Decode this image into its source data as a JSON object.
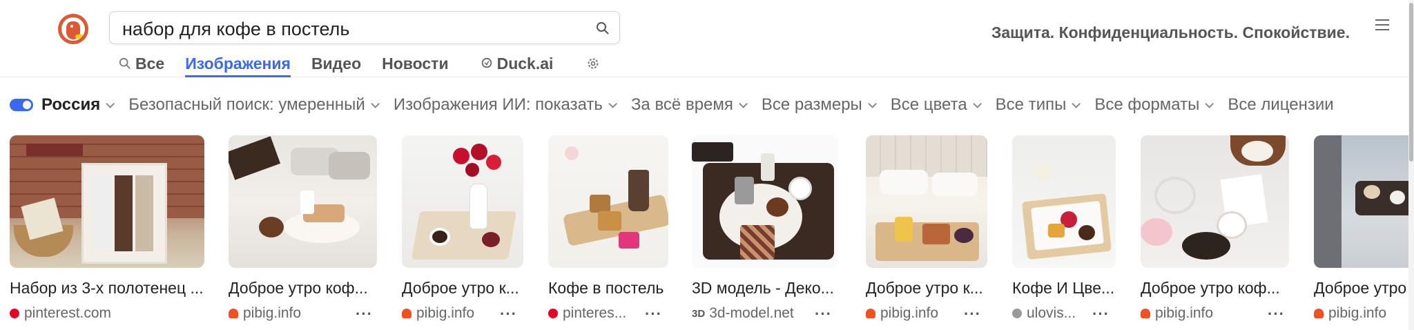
{
  "search": {
    "query": "набор для кофе в постель"
  },
  "tagline": "Защита. Конфиденциальность. Спокойствие.",
  "tabs": [
    {
      "label": "Все",
      "icon": "search-icon"
    },
    {
      "label": "Изображения",
      "active": true
    },
    {
      "label": "Видео"
    },
    {
      "label": "Новости"
    },
    {
      "label": "Duck.ai",
      "icon": "chat-icon"
    },
    {
      "label": "",
      "icon": "gear-icon"
    }
  ],
  "filters": {
    "region": "Россия",
    "safe_search": "Безопасный поиск: умеренный",
    "ai_images": "Изображения ИИ: показать",
    "time": "За всё время",
    "size": "Все размеры",
    "color": "Все цвета",
    "type": "Все типы",
    "format": "Все форматы",
    "license": "Все лицензии"
  },
  "results": [
    {
      "title": "Набор из 3-х полотенец ...",
      "source": "pinterest.com",
      "source_color": "#e60023",
      "more": "···"
    },
    {
      "title": "Доброе утро коф...",
      "source": "pibig.info",
      "source_color": "#f25022",
      "more": "···"
    },
    {
      "title": "Доброе утро к...",
      "source": "pibig.info",
      "source_color": "#f25022",
      "more": "···"
    },
    {
      "title": "Кофе в постель",
      "source": "pinteres...",
      "source_color": "#e60023",
      "more": "···"
    },
    {
      "title": "3D модель - Деко...",
      "source": "3d-model.net",
      "source_color": "#555555",
      "source_badge": "3D",
      "more": "···"
    },
    {
      "title": "Доброе утро к...",
      "source": "pibig.info",
      "source_color": "#f25022",
      "more": "···"
    },
    {
      "title": "Кофе И Цве...",
      "source": "ulovis...",
      "source_color": "#999999",
      "more": "···"
    },
    {
      "title": "Доброе утро коф...",
      "source": "pibig.info",
      "source_color": "#f25022",
      "more": "···"
    },
    {
      "title": "Доброе утро",
      "source": "pibig.info",
      "source_color": "#f25022",
      "more": ""
    }
  ],
  "colors": {
    "accent": "#3969ef",
    "brand": "#de5833"
  }
}
